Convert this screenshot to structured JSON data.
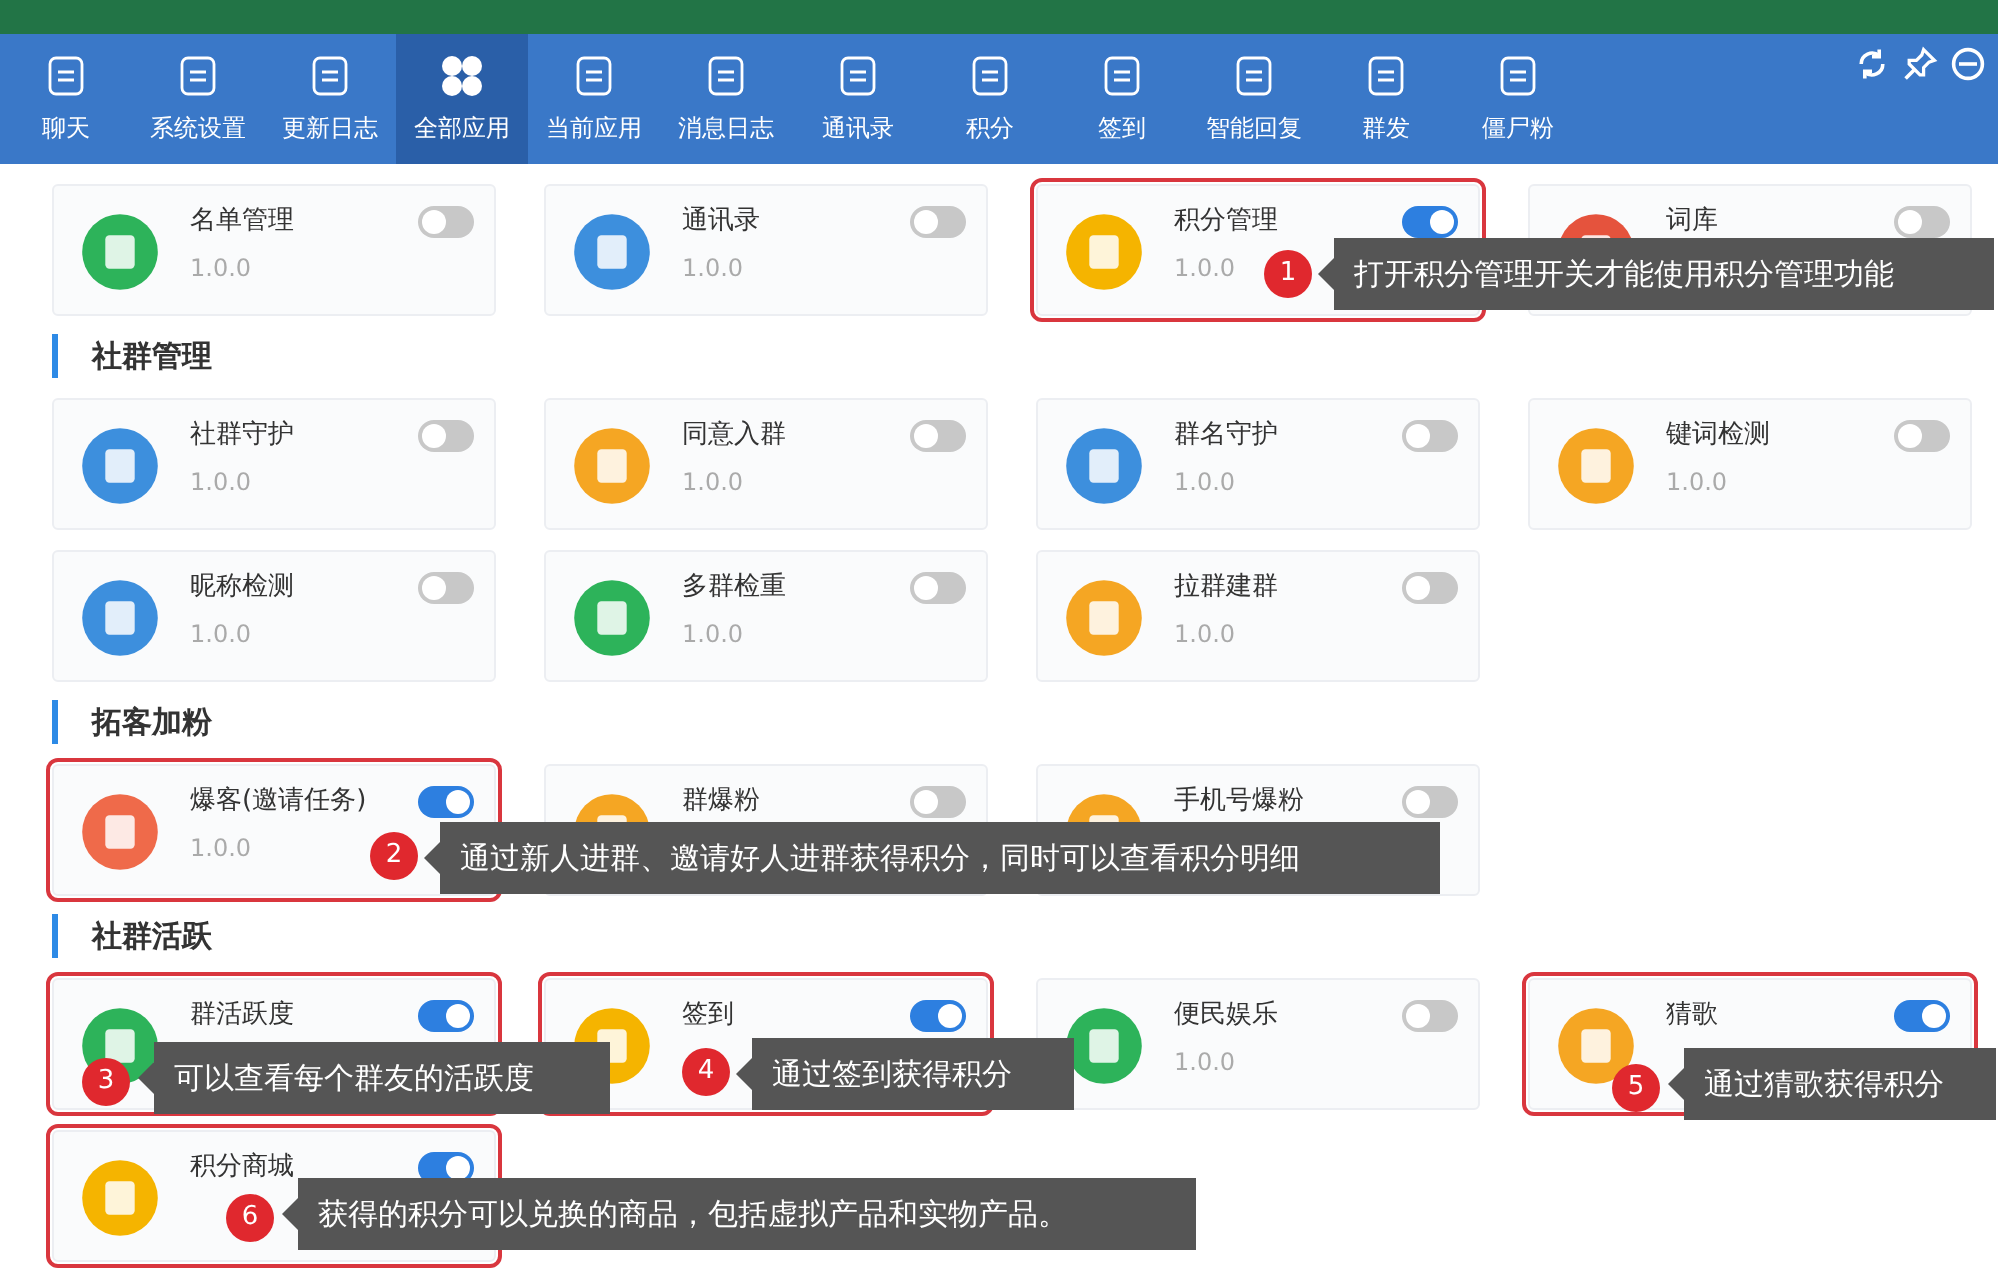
{
  "nav": {
    "items": [
      {
        "label": "聊天",
        "selected": false
      },
      {
        "label": "系统设置",
        "selected": false
      },
      {
        "label": "更新日志",
        "selected": false
      },
      {
        "label": "全部应用",
        "selected": true
      },
      {
        "label": "当前应用",
        "selected": false
      },
      {
        "label": "消息日志",
        "selected": false
      },
      {
        "label": "通讯录",
        "selected": false
      },
      {
        "label": "积分",
        "selected": false
      },
      {
        "label": "签到",
        "selected": false
      },
      {
        "label": "智能回复",
        "selected": false
      },
      {
        "label": "群发",
        "selected": false
      },
      {
        "label": "僵尸粉",
        "selected": false
      }
    ]
  },
  "sections": [
    {
      "apps": [
        {
          "name": "名单管理",
          "version": "1.0.0",
          "on": false,
          "highlighted": false
        },
        {
          "name": "通讯录",
          "version": "1.0.0",
          "on": false,
          "highlighted": false
        },
        {
          "name": "积分管理",
          "version": "1.0.0",
          "on": true,
          "highlighted": true
        },
        {
          "name": "词库",
          "on": false,
          "highlighted": false
        }
      ]
    },
    {
      "title": "社群管理",
      "apps": [
        {
          "name": "社群守护",
          "version": "1.0.0",
          "on": false,
          "highlighted": false
        },
        {
          "name": "同意入群",
          "version": "1.0.0",
          "on": false,
          "highlighted": false
        },
        {
          "name": "群名守护",
          "version": "1.0.0",
          "on": false,
          "highlighted": false
        },
        {
          "name": "键词检测",
          "version": "1.0.0",
          "on": false,
          "highlighted": false
        },
        {
          "name": "昵称检测",
          "version": "1.0.0",
          "on": false,
          "highlighted": false
        },
        {
          "name": "多群检重",
          "version": "1.0.0",
          "on": false,
          "highlighted": false
        },
        {
          "name": "拉群建群",
          "version": "1.0.0",
          "on": false,
          "highlighted": false
        }
      ]
    },
    {
      "title": "拓客加粉",
      "apps": [
        {
          "name": "爆客(邀请任务)",
          "version": "1.0.0",
          "on": true,
          "highlighted": true
        },
        {
          "name": "群爆粉",
          "on": false,
          "highlighted": false
        },
        {
          "name": "手机号爆粉",
          "on": false,
          "highlighted": false
        }
      ]
    },
    {
      "title": "社群活跃",
      "apps": [
        {
          "name": "群活跃度",
          "on": true,
          "highlighted": true
        },
        {
          "name": "签到",
          "on": true,
          "highlighted": true
        },
        {
          "name": "便民娱乐",
          "version": "1.0.0",
          "on": false,
          "highlighted": false
        },
        {
          "name": "猜歌",
          "on": true,
          "highlighted": true
        },
        {
          "name": "积分商城",
          "on": true,
          "highlighted": true
        }
      ]
    }
  ],
  "annotations": [
    {
      "number": "1",
      "text": "打开积分管理开关才能使用积分管理功能"
    },
    {
      "number": "2",
      "text": "通过新人进群、邀请好人进群获得积分，同时可以查看积分明细"
    },
    {
      "number": "3",
      "text": "可以查看每个群友的活跃度"
    },
    {
      "number": "4",
      "text": "通过签到获得积分"
    },
    {
      "number": "5",
      "text": "通过猜歌获得积分"
    },
    {
      "number": "6",
      "text": "获得的积分可以兑换的商品，包括虚拟产品和实物产品。"
    }
  ]
}
